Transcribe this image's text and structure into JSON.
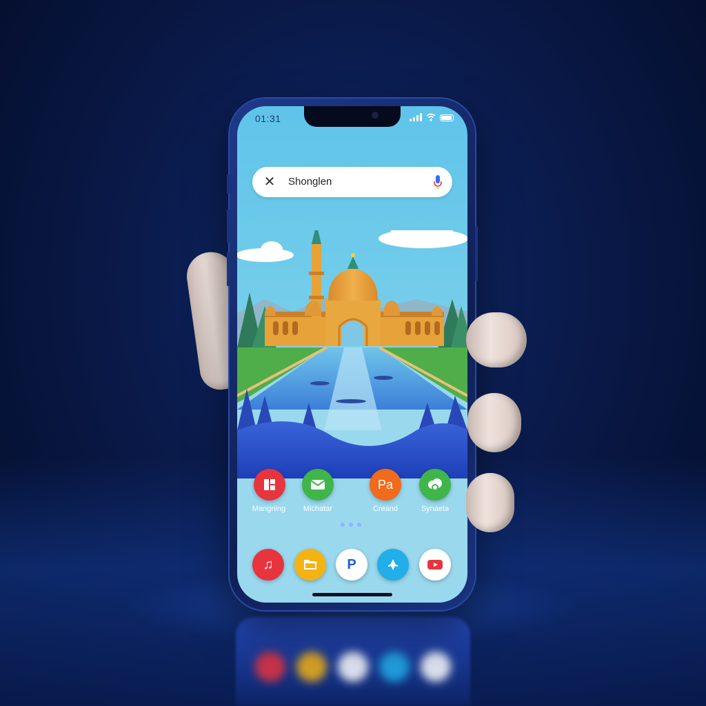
{
  "status_bar": {
    "time": "01:31"
  },
  "search": {
    "query": "Shonglen"
  },
  "icons": {
    "close": "close-icon",
    "mic": "mic-icon",
    "wifi": "wifi-icon",
    "battery": "battery-icon",
    "signal": "signal-icon"
  },
  "home_apps": [
    {
      "label": "Mangning",
      "icon": "grid-icon",
      "color": "#e8343d",
      "glyph": ""
    },
    {
      "label": "Michatar",
      "icon": "mail-icon",
      "color": "#3fb54a",
      "glyph": ""
    },
    {
      "label": "Creand",
      "icon": "pa-icon",
      "color": "#f26a1b",
      "glyph": "Pa"
    },
    {
      "label": "Synaeta",
      "icon": "cloud-app-icon",
      "color": "#3fb54a",
      "glyph": ""
    }
  ],
  "dock_apps": [
    {
      "icon": "music-icon",
      "color": "#e8343d",
      "glyph": "♫"
    },
    {
      "icon": "folder-icon",
      "color": "#f5b313",
      "glyph": ""
    },
    {
      "icon": "p-app-icon",
      "color": "#ffffff",
      "glyph": "P"
    },
    {
      "icon": "flower-app-icon",
      "color": "#22aee8",
      "glyph": ""
    },
    {
      "icon": "video-play-icon",
      "color": "#ffffff",
      "glyph": ""
    }
  ],
  "colors": {
    "background": "#0a1a4a",
    "phone_frame": "#1e3a8a",
    "sky": "#5fc4ea",
    "dome": "#e7a23a"
  }
}
